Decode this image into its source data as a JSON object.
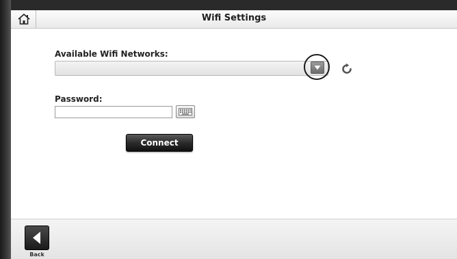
{
  "header": {
    "title": "Wifi Settings",
    "home_icon": "home-icon"
  },
  "wifi": {
    "networks_label": "Available Wifi Networks:",
    "selected_network": "",
    "dropdown_icon": "chevron-down-icon",
    "refresh_icon": "refresh-icon"
  },
  "password": {
    "label": "Password:",
    "value": "",
    "keyboard_icon": "keyboard-icon"
  },
  "actions": {
    "connect_label": "Connect"
  },
  "footer": {
    "back_label": "Back",
    "back_icon": "back-arrow-icon"
  }
}
